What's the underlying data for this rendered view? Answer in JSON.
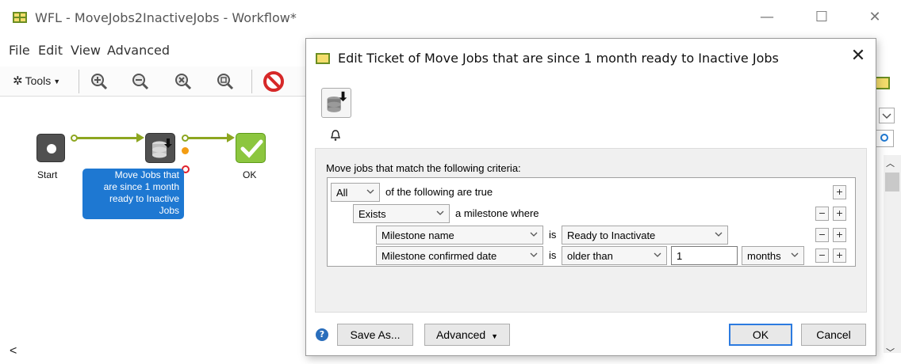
{
  "window": {
    "title": "WFL - MoveJobs2InactiveJobs - Workflow*",
    "minimize": "—",
    "maximize": "☐",
    "close": "✕"
  },
  "menu": {
    "file": "File",
    "edit": "Edit",
    "view": "View",
    "advanced": "Advanced"
  },
  "toolbar": {
    "tools_label": "Tools"
  },
  "canvas": {
    "start_label": "Start",
    "ok_label": "OK",
    "move_lines": [
      "Move Jobs that",
      "are since 1 month",
      "ready to Inactive",
      "Jobs"
    ],
    "scroll_left": "<"
  },
  "dialog": {
    "title": "Edit Ticket of Move Jobs that are since 1 month ready to Inactive Jobs",
    "close": "✕",
    "criteria_label": "Move jobs that match the following criteria:",
    "row1": {
      "quantifier": "All",
      "text": "of the following are true"
    },
    "row2": {
      "exists": "Exists",
      "text": "a milestone where"
    },
    "row3": {
      "field": "Milestone name",
      "is": "is",
      "value": "Ready to Inactivate"
    },
    "row4": {
      "field": "Milestone confirmed date",
      "is": "is",
      "operator": "older than",
      "amount": "1",
      "unit": "months"
    },
    "plus": "+",
    "minus": "−",
    "help": "?",
    "save_as": "Save As...",
    "advanced": "Advanced",
    "ok": "OK",
    "cancel": "Cancel"
  },
  "colors": {
    "accent": "#1e78d2",
    "connector": "#8da620",
    "ok_node": "#8cc63f",
    "error": "#e0202c",
    "warning": "#f39c12"
  }
}
